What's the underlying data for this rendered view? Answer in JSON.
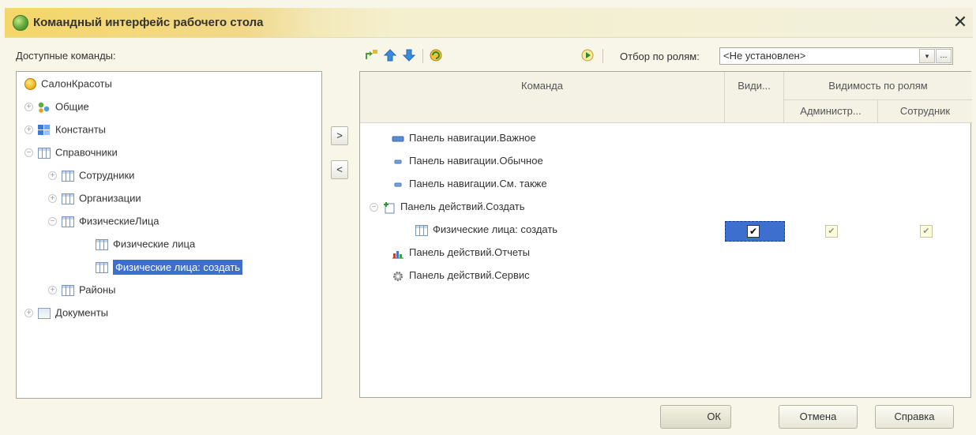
{
  "window": {
    "title": "Командный интерфейс рабочего стола",
    "close_glyph": "✕"
  },
  "left_panel": {
    "label": "Доступные команды:",
    "tree": [
      {
        "label": "СалонКрасоты",
        "icon": "coin-icon",
        "expander": ""
      },
      {
        "label": "Общие",
        "icon": "subsystems-icon",
        "expander": "+"
      },
      {
        "label": "Константы",
        "icon": "constants-icon",
        "expander": "+"
      },
      {
        "label": "Справочники",
        "icon": "catalog-icon",
        "expander": "−"
      },
      {
        "label": "Сотрудники",
        "icon": "catalog-icon",
        "expander": "+"
      },
      {
        "label": "Организации",
        "icon": "catalog-icon",
        "expander": "+"
      },
      {
        "label": "ФизическиеЛица",
        "icon": "catalog-icon",
        "expander": "−"
      },
      {
        "label": "Физические лица",
        "icon": "catalog-icon",
        "expander": ""
      },
      {
        "label": "Физические лица: создать",
        "icon": "catalog-icon",
        "expander": "",
        "selected": true
      },
      {
        "label": "Районы",
        "icon": "catalog-icon",
        "expander": "+"
      },
      {
        "label": "Документы",
        "icon": "document-icon",
        "expander": "+"
      }
    ]
  },
  "move_buttons": {
    "add": ">",
    "remove": "<"
  },
  "toolbar": {
    "filter_label": "Отбор по ролям:",
    "filter_value": "<Не установлен>",
    "dropdown_glyph": "▾",
    "more_glyph": "..."
  },
  "grid": {
    "headers": {
      "command": "Команда",
      "visible": "Види...",
      "roles_group": "Видимость по ролям",
      "role_admin": "Администр...",
      "role_employee": "Сотрудник"
    },
    "rows": [
      {
        "label": "Панель навигации.Важное",
        "icon": "nav-important-icon"
      },
      {
        "label": "Панель навигации.Обычное",
        "icon": "nav-normal-icon"
      },
      {
        "label": "Панель навигации.См. также",
        "icon": "nav-seealso-icon"
      },
      {
        "label": "Панель действий.Создать",
        "icon": "create-icon",
        "expander": "−"
      },
      {
        "label": "Физические лица: создать",
        "icon": "catalog-icon",
        "checks": {
          "visible": "✔",
          "admin": "✔",
          "employee": "✔"
        }
      },
      {
        "label": "Панель действий.Отчеты",
        "icon": "reports-icon"
      },
      {
        "label": "Панель действий.Сервис",
        "icon": "service-icon"
      }
    ]
  },
  "buttons": {
    "ok": "ОК",
    "cancel": "Отмена",
    "help": "Справка"
  }
}
